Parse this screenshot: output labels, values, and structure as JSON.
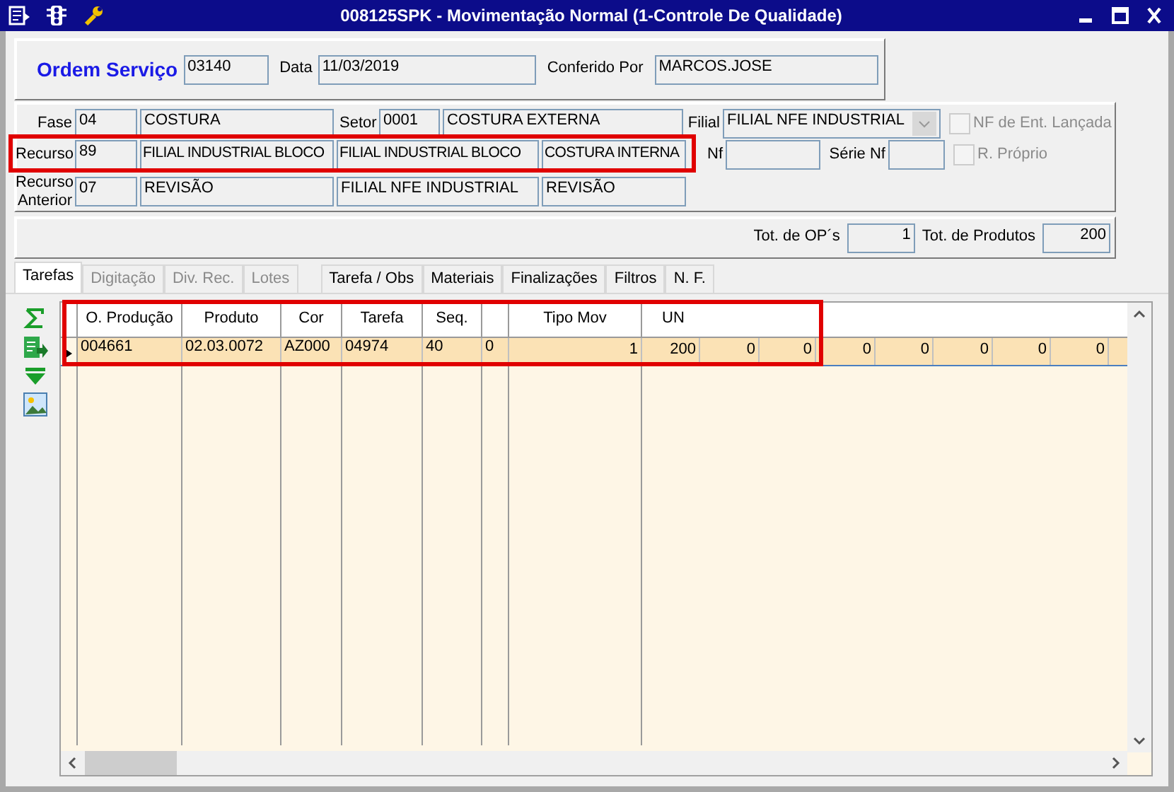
{
  "window": {
    "title": "008125SPK - Movimentação Normal (1-Controle De Qualidade)"
  },
  "header": {
    "title": "Ordem Serviço",
    "order": "03140",
    "date_label": "Data",
    "date": "11/03/2019",
    "checked_by_label": "Conferido Por",
    "checked_by": "MARCOS.JOSE"
  },
  "details": {
    "fase": {
      "label": "Fase",
      "code": "04",
      "name": "COSTURA"
    },
    "setor": {
      "label": "Setor",
      "code": "0001",
      "name": "COSTURA EXTERNA"
    },
    "filial": {
      "label": "Filial",
      "value": "FILIAL NFE INDUSTRIAL",
      "disabled": true
    },
    "nf_lancada": {
      "label": "NF de Ent. Lançada",
      "checked": false,
      "disabled": true
    },
    "recurso": {
      "label": "Recurso",
      "code": "89",
      "name": "FILIAL INDUSTRIAL BLOCO",
      "filial": "FILIAL INDUSTRIAL BLOCO",
      "setor": "COSTURA INTERNA"
    },
    "nf": {
      "label": "Nf"
    },
    "serie_nf": {
      "label": "Série Nf"
    },
    "r_proprio": {
      "label": "R. Próprio",
      "checked": false,
      "disabled": true
    },
    "recurso_anterior": {
      "label": "Recurso Anterior",
      "code": "07",
      "name": "REVISÃO",
      "filial": "FILIAL NFE INDUSTRIAL",
      "setor": "REVISÃO"
    }
  },
  "totals": {
    "ops_label": "Tot. de OP´s",
    "ops": "1",
    "products_label": "Tot. de Produtos",
    "products": "200"
  },
  "tabs": [
    {
      "label": "Tarefas",
      "selected": true,
      "disabled": false
    },
    {
      "label": "Digitação",
      "selected": false,
      "disabled": true
    },
    {
      "label": "Div. Rec.",
      "selected": false,
      "disabled": true
    },
    {
      "label": "Lotes",
      "selected": false,
      "disabled": true
    },
    {
      "label": "Tarefa / Obs",
      "selected": false,
      "disabled": false
    },
    {
      "label": "Materiais",
      "selected": false,
      "disabled": false
    },
    {
      "label": "Finalizações",
      "selected": false,
      "disabled": false
    },
    {
      "label": "Filtros",
      "selected": false,
      "disabled": false
    },
    {
      "label": "N. F.",
      "selected": false,
      "disabled": false
    }
  ],
  "table": {
    "columns": [
      {
        "label": "O. Produção"
      },
      {
        "label": "Produto"
      },
      {
        "label": "Cor"
      },
      {
        "label": "Tarefa"
      },
      {
        "label": "Seq."
      },
      {},
      {
        "label": "Tipo Mov"
      },
      {
        "label": "UN"
      },
      {},
      {},
      {},
      {},
      {},
      {},
      {},
      {},
      {}
    ],
    "rows": [
      {
        "selected": true,
        "cells": [
          "004661",
          "02.03.0072",
          "AZ000",
          "04974",
          "40",
          "0",
          "1",
          "200",
          "0",
          "0",
          "0",
          "0",
          "0",
          "0",
          "0"
        ]
      }
    ]
  }
}
